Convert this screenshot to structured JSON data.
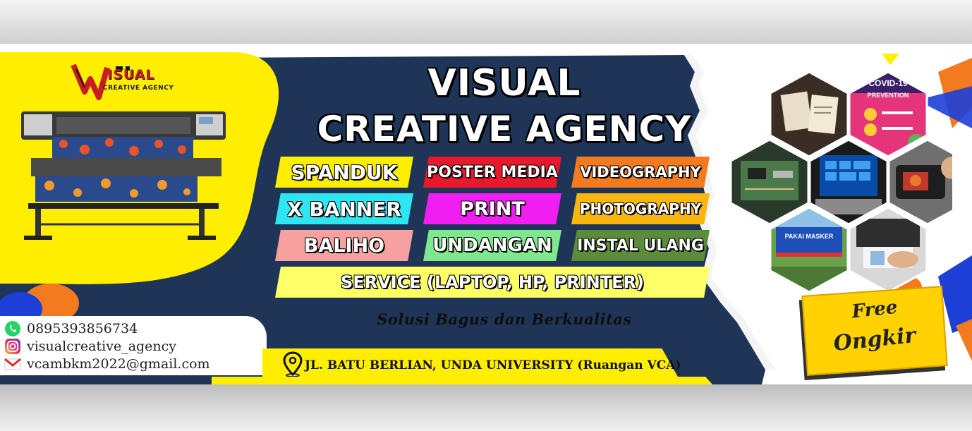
{
  "brand": {
    "logo_word": "ISUAL",
    "logo_sub": "CREATIVE AGENCY"
  },
  "title": {
    "line1": "VISUAL",
    "line2": "CREATIVE AGENCY"
  },
  "services": [
    {
      "label": "SPANDUK",
      "color": "#ffee00"
    },
    {
      "label": "POSTER MEDIA",
      "color": "#e8192c"
    },
    {
      "label": "VIDEOGRAPHY",
      "color": "#f47a20"
    },
    {
      "label": "X BANNER",
      "color": "#2ee6f2"
    },
    {
      "label": "PRINT",
      "color": "#f01ef0"
    },
    {
      "label": "PHOTOGRAPHY",
      "color": "#f7b710"
    },
    {
      "label": "BALIHO",
      "color": "#f7a0a0"
    },
    {
      "label": "UNDANGAN",
      "color": "#7ee88c"
    },
    {
      "label": "INSTAL ULANG",
      "color": "#5b8c3a"
    },
    {
      "label": "SERVICE (LAPTOP, HP, PRINTER)",
      "color": "#ffff66"
    }
  ],
  "tagline": "Solusi Bagus dan Berkualitas",
  "contacts": {
    "phone": "0895393856734",
    "instagram": "visualcreative_agency",
    "email": "vcambkm2022@gmail.com"
  },
  "address": "JL. BATU BERLIAN, UNDA UNIVERSITY (Ruangan VCA)",
  "promo": {
    "line1": "Free",
    "line2": "Ongkir"
  },
  "colors": {
    "navy": "#1f3558",
    "yellow": "#ffee00",
    "orange": "#f47a20",
    "blue": "#1d3fd8"
  },
  "gallery": [
    {
      "icon": "invitation-card-photo"
    },
    {
      "icon": "covid-poster-photo",
      "caption": "COVID-19 PREVENTION"
    },
    {
      "icon": "circuit-board-photo"
    },
    {
      "icon": "laptop-windows-photo"
    },
    {
      "icon": "camera-photo"
    },
    {
      "icon": "banner-masker-photo",
      "caption": "PAKAI MASKER"
    },
    {
      "icon": "printer-hand-photo"
    }
  ]
}
